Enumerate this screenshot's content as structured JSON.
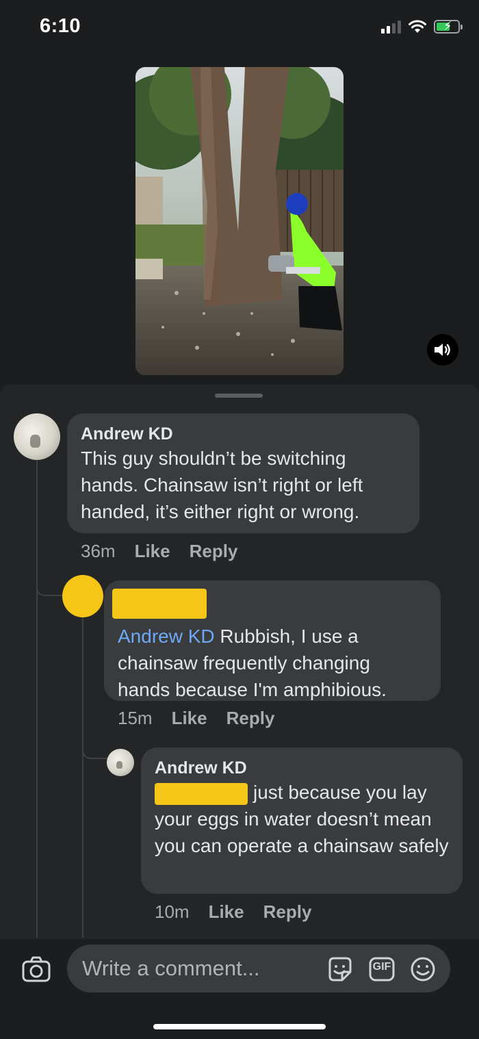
{
  "status_bar": {
    "time": "6:10"
  },
  "comments": [
    {
      "author": "Andrew KD",
      "text": "This guy shouldn’t be switching hands. Chainsaw isn’t right or left handed, it’s either right or wrong.",
      "time": "36m",
      "like_label": "Like",
      "reply_label": "Reply"
    },
    {
      "mention": "Andrew KD",
      "text": " Rubbish, I use a chainsaw frequently changing hands because I'm amphibious.",
      "time": "15m",
      "like_label": "Like",
      "reply_label": "Reply"
    },
    {
      "author": "Andrew KD",
      "text": "just because you lay your eggs in water doesn’t mean you can operate a chainsaw safely",
      "time": "10m",
      "like_label": "Like",
      "reply_label": "Reply"
    }
  ],
  "composer": {
    "placeholder": "Write a comment...",
    "gif_label": "GIF"
  },
  "icons": [
    "signal-icon",
    "wifi-icon",
    "battery-icon",
    "sound-icon",
    "camera-icon",
    "sticker-icon",
    "gif-icon",
    "emoji-icon"
  ]
}
